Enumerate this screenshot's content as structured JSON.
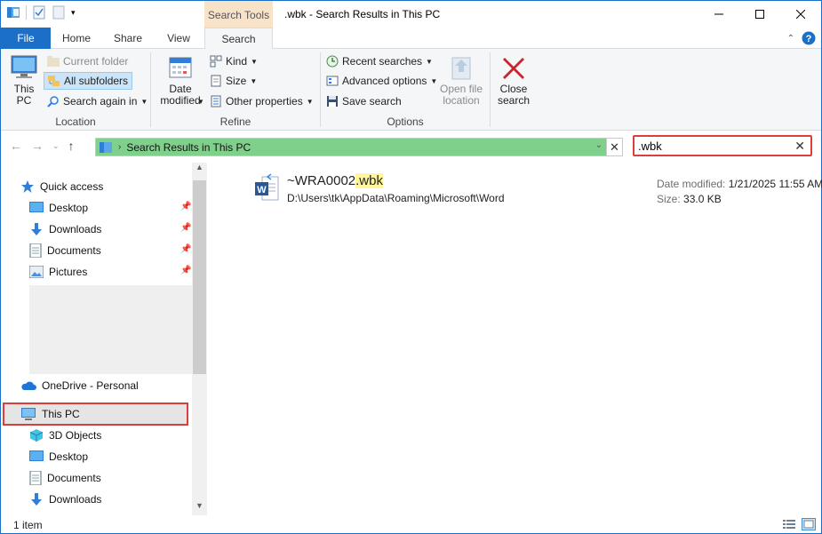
{
  "window": {
    "title": ".wbk - Search Results in This PC",
    "context_tab": "Search Tools",
    "controls": [
      "minimize",
      "maximize",
      "close"
    ]
  },
  "tabs": [
    {
      "label": "File"
    },
    {
      "label": "Home"
    },
    {
      "label": "Share"
    },
    {
      "label": "View"
    },
    {
      "label": "Search",
      "active": true
    }
  ],
  "ribbon": {
    "location": {
      "label": "Location",
      "this_pc": "This\nPC",
      "current_folder": "Current folder",
      "all_subfolders": "All subfolders",
      "search_again": "Search again in"
    },
    "refine": {
      "label": "Refine",
      "date_modified": "Date\nmodified",
      "kind": "Kind",
      "size": "Size",
      "other_properties": "Other properties"
    },
    "options": {
      "label": "Options",
      "recent_searches": "Recent searches",
      "advanced_options": "Advanced options",
      "save_search": "Save search",
      "open_file_location": "Open file\nlocation"
    },
    "close": {
      "close_search": "Close\nsearch"
    }
  },
  "address_bar": {
    "path": "Search Results in This PC"
  },
  "search": {
    "value": ".wbk"
  },
  "nav_pane": {
    "quick_access": "Quick access",
    "qa_items": [
      "Desktop",
      "Downloads",
      "Documents",
      "Pictures"
    ],
    "onedrive": "OneDrive - Personal",
    "this_pc": "This PC",
    "pc_items": [
      "3D Objects",
      "Desktop",
      "Documents",
      "Downloads"
    ]
  },
  "results": [
    {
      "name_prefix": "~WRA0002",
      "name_match": ".wbk",
      "path": "D:\\Users\\tk\\AppData\\Roaming\\Microsoft\\Word",
      "date_label": "Date modified:",
      "date_value": "1/21/2025 11:55 AM",
      "size_label": "Size:",
      "size_value": "33.0 KB",
      "icon": "word-document-icon"
    }
  ],
  "status": {
    "item_count": "1 item"
  },
  "colors": {
    "accent": "#1c6fc7",
    "address_highlight": "#7fd08a",
    "callout_red": "#d9403b",
    "match_highlight": "#fff69b"
  }
}
